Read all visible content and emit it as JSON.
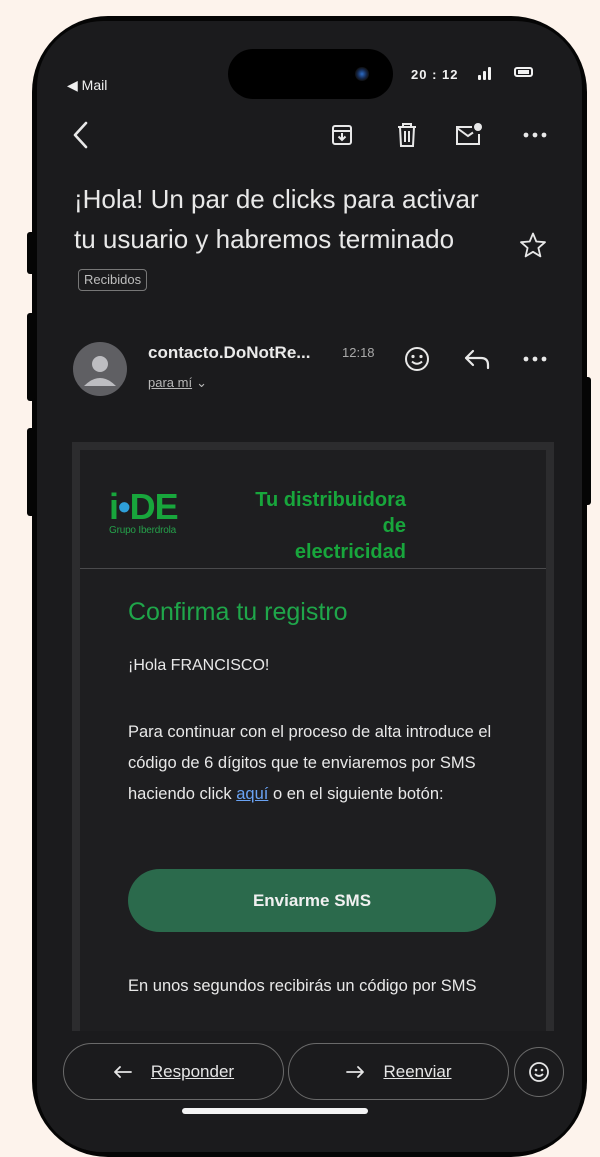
{
  "status_bar": {
    "back_app": "◀ Mail",
    "time": "20 : 12"
  },
  "email": {
    "subject": "¡Hola! Un par de clicks para activar tu usuario y habremos terminado",
    "label": "Recibidos",
    "sender": "contacto.DoNotRe...",
    "time": "12:18",
    "recipient": "para mí",
    "content": {
      "logo_text": "i-DE",
      "logo_subtext": "Grupo Iberdrola",
      "tagline_line1": "Tu distribuidora de",
      "tagline_line2": "electricidad",
      "title": "Confirma tu registro",
      "greeting": "¡Hola FRANCISCO!",
      "body_before_link": "Para continuar con el proceso de alta introduce el código de 6 dígitos que te enviaremos por SMS haciendo click ",
      "link_text": "aquí",
      "body_after_link": " o en el siguiente botón:",
      "button_label": "Enviarme SMS",
      "footer_text": "En unos segundos recibirás un código por SMS"
    }
  },
  "actions": {
    "reply": "Responder",
    "forward": "Reenviar"
  },
  "colors": {
    "brand_green": "#18a63c",
    "button_green": "#2b6a4c",
    "link_blue": "#6aa3f4",
    "background": "#1b1b1d"
  }
}
